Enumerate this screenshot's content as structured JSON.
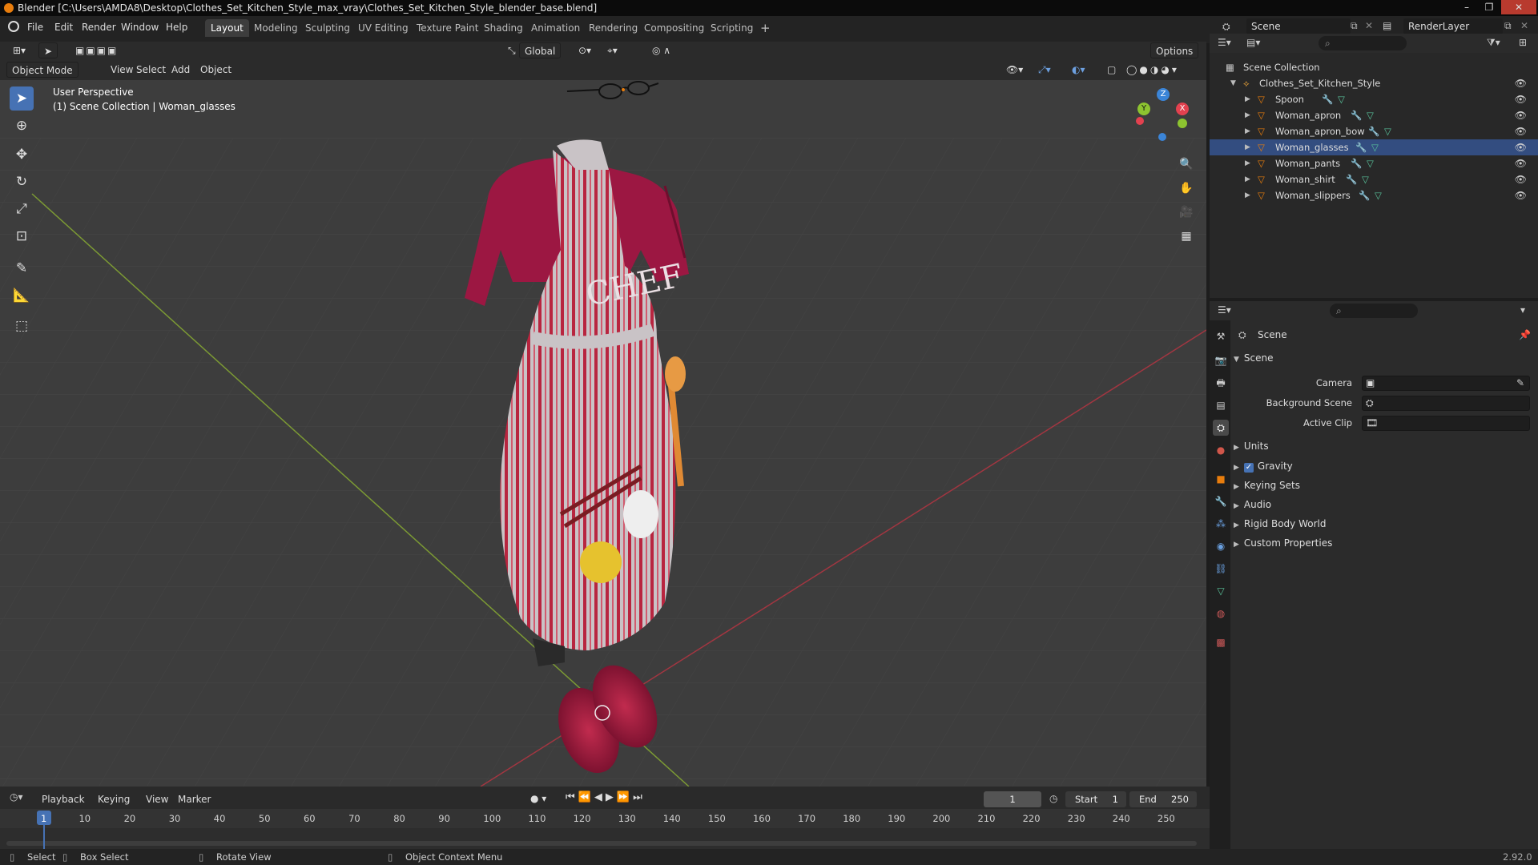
{
  "window": {
    "title": "Blender [C:\\Users\\AMDA8\\Desktop\\Clothes_Set_Kitchen_Style_max_vray\\Clothes_Set_Kitchen_Style_blender_base.blend]"
  },
  "menubar": {
    "menus": [
      "File",
      "Edit",
      "Render",
      "Window",
      "Help"
    ],
    "workspaces": [
      "Layout",
      "Modeling",
      "Sculpting",
      "UV Editing",
      "Texture Paint",
      "Shading",
      "Animation",
      "Rendering",
      "Compositing",
      "Scripting"
    ],
    "active_workspace": "Layout",
    "add_tab": "+",
    "scene_name": "Scene",
    "view_layer": "RenderLayer"
  },
  "viewport_header": {
    "mode": "Object Mode",
    "menus": [
      "View",
      "Select",
      "Add",
      "Object"
    ],
    "transform_orientation": "Global",
    "options": "Options"
  },
  "viewport_overlay": {
    "perspective": "User Perspective",
    "collection_info": "(1) Scene Collection | Woman_glasses"
  },
  "gizmo": {
    "axes": [
      "X",
      "Y",
      "Z"
    ],
    "colors": {
      "x": "#e3414f",
      "y": "#8dc430",
      "z": "#3b85d8"
    }
  },
  "outliner": {
    "root": "Scene Collection",
    "collection": "Clothes_Set_Kitchen_Style",
    "objects": [
      "Spoon",
      "Woman_apron",
      "Woman_apron_bow",
      "Woman_glasses",
      "Woman_pants",
      "Woman_shirt",
      "Woman_slippers"
    ],
    "selected": "Woman_glasses"
  },
  "properties": {
    "context": "Scene",
    "section": "Scene",
    "fields": [
      {
        "label": "Camera",
        "value": ""
      },
      {
        "label": "Background Scene",
        "value": ""
      },
      {
        "label": "Active Clip",
        "value": ""
      }
    ],
    "panels": [
      "Units",
      "Gravity",
      "Keying Sets",
      "Audio",
      "Rigid Body World",
      "Custom Properties"
    ],
    "gravity_enabled": true
  },
  "timeline": {
    "menus": [
      "Playback",
      "Keying",
      "View",
      "Marker"
    ],
    "current_frame": "1",
    "start_label": "Start",
    "start": "1",
    "end_label": "End",
    "end": "250",
    "ruler": [
      "1",
      "10",
      "20",
      "30",
      "40",
      "50",
      "60",
      "70",
      "80",
      "90",
      "100",
      "110",
      "120",
      "130",
      "140",
      "150",
      "160",
      "170",
      "180",
      "190",
      "200",
      "210",
      "220",
      "230",
      "240",
      "250"
    ]
  },
  "statusbar": {
    "select": "Select",
    "box_select": "Box Select",
    "rotate": "Rotate View",
    "context_menu": "Object Context Menu",
    "version": "2.92.0"
  },
  "colors": {
    "accent": "#4672b4",
    "object_orange": "#e87d0d",
    "apron_red": "#a8203c",
    "shirt": "#9a1840"
  }
}
